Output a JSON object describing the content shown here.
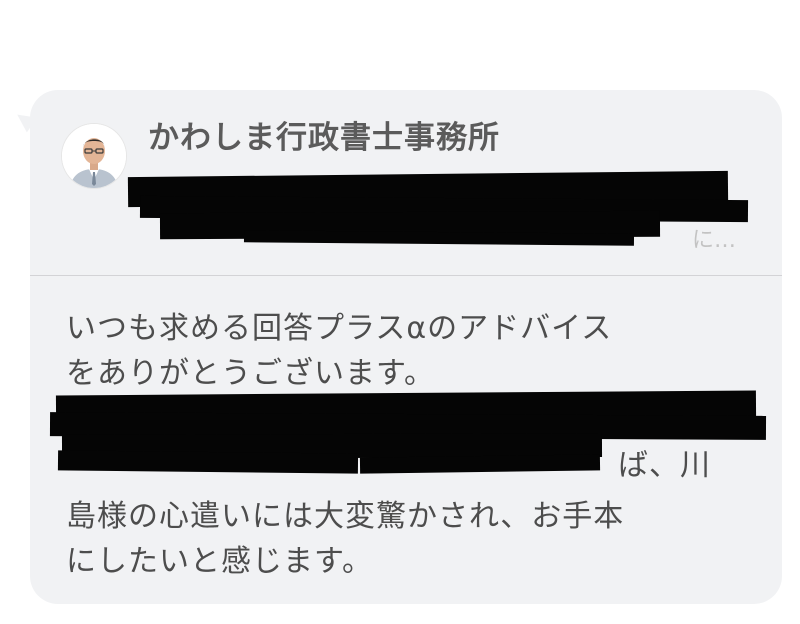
{
  "sender": {
    "name": "かわしま行政書士事務所"
  },
  "preview": {
    "line1_visible_fragment": "…",
    "line2_visible_fragment": "に…"
  },
  "message": {
    "line1": "いつも求める回答プラスαのアドバイス",
    "line2": "をありがとうございます。",
    "line4_visible_fragment": "ば、川",
    "line5": "島様の心遣いには大変驚かされ、お手本",
    "line6": "にしたいと感じます。"
  },
  "colors": {
    "bubble_background": "#f1f2f4",
    "text": "#4d4d4d",
    "name_text": "#5b5b5b",
    "redaction": "#050505"
  },
  "icons": {
    "avatar": "person-photo"
  }
}
